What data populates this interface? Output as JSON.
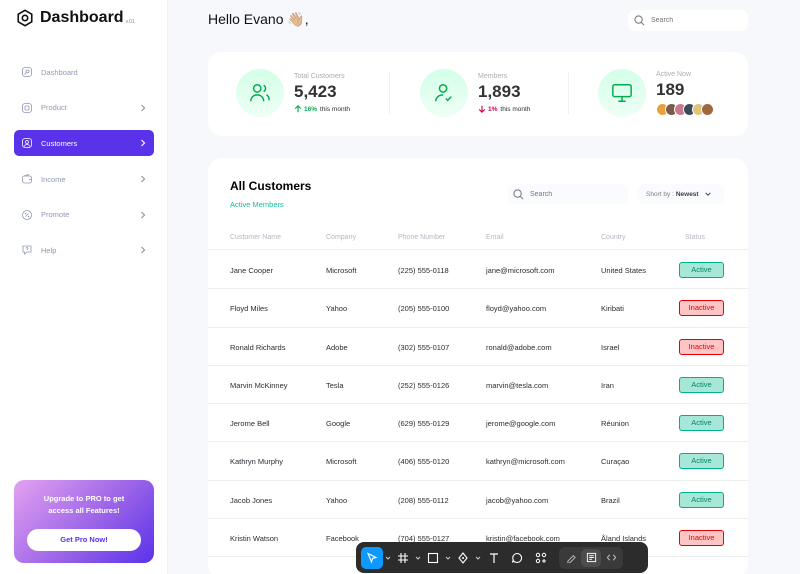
{
  "sidebar": {
    "brand": {
      "title": "Dashboard",
      "version": "v.01"
    },
    "items": [
      {
        "label": "Dashboard",
        "icon": "key-square-icon",
        "has_chevron": false,
        "active": false
      },
      {
        "label": "Product",
        "icon": "product-3d-icon",
        "has_chevron": true,
        "active": false
      },
      {
        "label": "Customers",
        "icon": "user-square-icon",
        "has_chevron": true,
        "active": true
      },
      {
        "label": "Income",
        "icon": "wallet-money-icon",
        "has_chevron": true,
        "active": false
      },
      {
        "label": "Promote",
        "icon": "discount-shape-icon",
        "has_chevron": true,
        "active": false
      },
      {
        "label": "Help",
        "icon": "message-question-icon",
        "has_chevron": true,
        "active": false
      }
    ],
    "promo": {
      "text": "Upgrade to  PRO to get access all Features!",
      "button": "Get Pro Now!"
    }
  },
  "header": {
    "greeting": "Hello Evano 👋🏼,",
    "search_placeholder": "Search"
  },
  "stats": [
    {
      "label": "Total Customers",
      "value": "5,423",
      "trend": "16%",
      "trend_dir": "up",
      "trend_suffix": "this month",
      "icon": "profile-2user-icon"
    },
    {
      "label": "Members",
      "value": "1,893",
      "trend": "1%",
      "trend_dir": "down",
      "trend_suffix": "this month",
      "icon": "profile-tick-icon"
    },
    {
      "label": "Active Now",
      "value": "189",
      "icon": "monitor-icon",
      "avatars": 5
    }
  ],
  "customers": {
    "title": "All Customers",
    "subtitle": "Active Members",
    "search_placeholder": "Search",
    "sort": {
      "prefix": "Short by :",
      "value": "Newest"
    },
    "columns": [
      "Customer Name",
      "Company",
      "Phone Number",
      "Email",
      "Country",
      "Status"
    ],
    "rows": [
      {
        "name": "Jane Cooper",
        "company": "Microsoft",
        "phone": "(225) 555-0118",
        "email": "jane@microsoft.com",
        "country": "United States",
        "status": "Active"
      },
      {
        "name": "Floyd Miles",
        "company": "Yahoo",
        "phone": "(205) 555-0100",
        "email": "floyd@yahoo.com",
        "country": "Kiribati",
        "status": "Inactive"
      },
      {
        "name": "Ronald Richards",
        "company": "Adobe",
        "phone": "(302) 555-0107",
        "email": "ronald@adobe.com",
        "country": "Israel",
        "status": "Inactive"
      },
      {
        "name": "Marvin McKinney",
        "company": "Tesla",
        "phone": "(252) 555-0126",
        "email": "marvin@tesla.com",
        "country": "Iran",
        "status": "Active"
      },
      {
        "name": "Jerome Bell",
        "company": "Google",
        "phone": "(629) 555-0129",
        "email": "jerome@google.com",
        "country": "Réunion",
        "status": "Active"
      },
      {
        "name": "Kathryn Murphy",
        "company": "Microsoft",
        "phone": "(406) 555-0120",
        "email": "kathryn@microsoft.com",
        "country": "Curaçao",
        "status": "Active"
      },
      {
        "name": "Jacob Jones",
        "company": "Yahoo",
        "phone": "(208) 555-0112",
        "email": "jacob@yahoo.com",
        "country": "Brazil",
        "status": "Active"
      },
      {
        "name": "Kristin Watson",
        "company": "Facebook",
        "phone": "(704) 555-0127",
        "email": "kristin@facebook.com",
        "country": "Åland Islands",
        "status": "Inactive"
      }
    ]
  },
  "colors": {
    "accent": "#5932ea",
    "active_text": "#008767",
    "inactive_text": "#df0404",
    "link_green": "#16c098",
    "toolbar_select": "#0d99ff"
  },
  "toolbar": {
    "tools": [
      "move-tool-icon",
      "frame-tool-icon",
      "shape-tool-icon",
      "pen-tool-icon",
      "text-tool-icon",
      "comment-tool-icon",
      "actions-icon"
    ],
    "modes": [
      "draw-mode-icon",
      "design-mode-icon",
      "dev-mode-icon"
    ]
  }
}
